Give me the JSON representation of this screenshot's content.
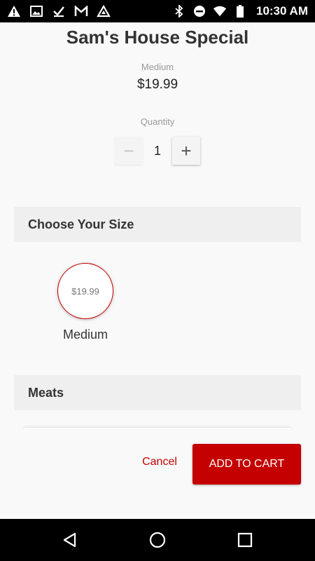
{
  "status_bar": {
    "time": "10:30 AM",
    "icons_left": [
      "warning-icon",
      "image-icon",
      "check-icon",
      "gmail-icon",
      "delta-icon"
    ],
    "icons_right": [
      "bluetooth-icon",
      "dnd-icon",
      "wifi-icon",
      "battery-icon"
    ]
  },
  "product": {
    "title": "Sam's House Special",
    "selected_size": "Medium",
    "price": "$19.99"
  },
  "quantity": {
    "label": "Quantity",
    "value": "1",
    "minus_symbol": "−",
    "plus_symbol": "+"
  },
  "sections": {
    "size_header": "Choose Your Size",
    "meats_header": "Meats"
  },
  "size_options": [
    {
      "price": "$19.99",
      "name": "Medium",
      "selected": true
    }
  ],
  "footer": {
    "cancel_label": "Cancel",
    "add_to_cart_label": "ADD TO CART"
  },
  "colors": {
    "accent": "#c40000",
    "section_bg": "#efefef",
    "page_bg": "#f9f9f9"
  },
  "nav_bar": {
    "icons": [
      "back-icon",
      "home-icon",
      "recents-icon"
    ]
  }
}
